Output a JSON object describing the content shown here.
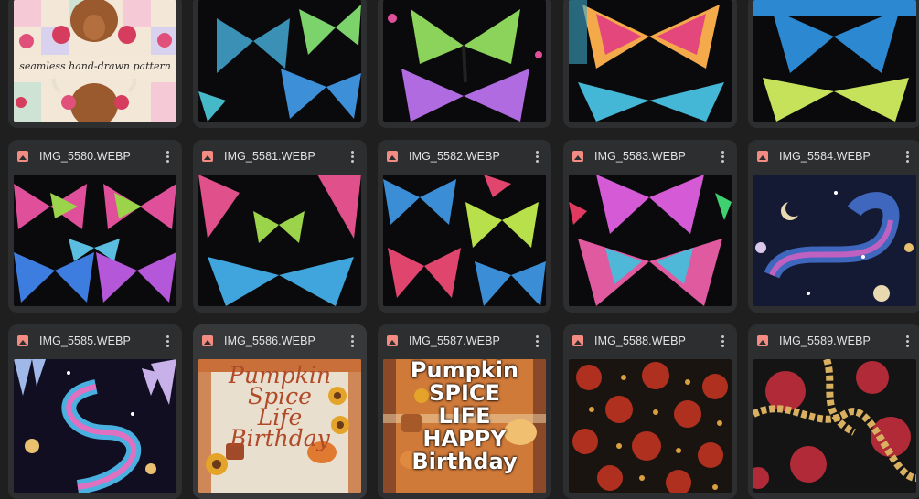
{
  "files": [
    {
      "name": "",
      "thumbnail": "highland-cow-roses-pattern",
      "caption": "seamless hand-drawn pattern"
    },
    {
      "name": "",
      "thumbnail": "blue-green-butterflies"
    },
    {
      "name": "",
      "thumbnail": "neon-drip-butterflies"
    },
    {
      "name": "",
      "thumbnail": "rainbow-drip-butterflies"
    },
    {
      "name": "",
      "thumbnail": "blue-green-drip-butterflies"
    },
    {
      "name": "IMG_5580.WEBP",
      "thumbnail": "pink-green-butterflies-pattern"
    },
    {
      "name": "IMG_5581.WEBP",
      "thumbnail": "pink-blue-butterflies"
    },
    {
      "name": "IMG_5582.WEBP",
      "thumbnail": "multicolor-butterflies"
    },
    {
      "name": "IMG_5583.WEBP",
      "thumbnail": "neon-pink-butterflies"
    },
    {
      "name": "IMG_5584.WEBP",
      "thumbnail": "cosmic-swirl-moons"
    },
    {
      "name": "IMG_5585.WEBP",
      "thumbnail": "crystal-rainbow-swirl"
    },
    {
      "name": "IMG_5586.WEBP",
      "thumbnail": "pumpkin-spice-life-birthday-plaid",
      "caption_lines": [
        "Pumpkin",
        "Spice",
        "Life",
        "Birthday"
      ]
    },
    {
      "name": "IMG_5587.WEBP",
      "thumbnail": "pumpkin-spice-life-happy-birthday",
      "caption_lines": [
        "Pumpkin",
        "SPICE",
        "LIFE",
        "HAPPY",
        "Birthday"
      ]
    },
    {
      "name": "IMG_5588.WEBP",
      "thumbnail": "red-roses-leopard"
    },
    {
      "name": "IMG_5589.WEBP",
      "thumbnail": "roses-gold-chain"
    }
  ],
  "colors": {
    "background": "#1f1f1f",
    "card": "#2d2e30",
    "card_highlighted": "#37383a",
    "text": "#e3e3e3",
    "image_icon": "#f28b82"
  },
  "icons": {
    "file_type": "image-icon",
    "menu": "more-vert-icon"
  }
}
